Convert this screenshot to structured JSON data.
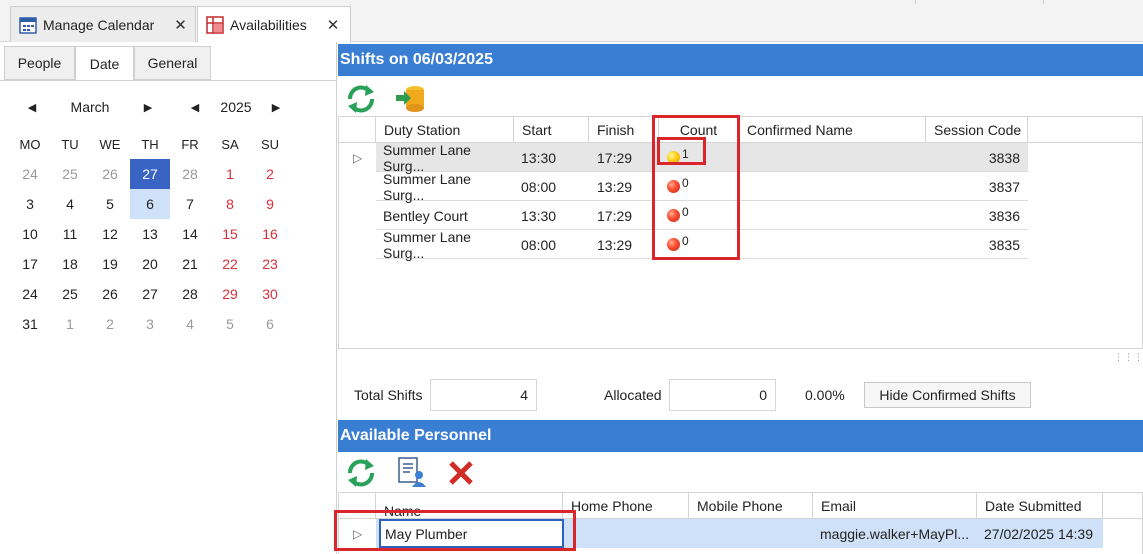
{
  "tabs": [
    {
      "label": "Manage Calendar",
      "close": "✕"
    },
    {
      "label": "Availabilities",
      "close": "✕"
    }
  ],
  "left": {
    "sub_tabs": [
      "People",
      "Date",
      "General"
    ],
    "month": "March",
    "year": "2025",
    "prev": "◀",
    "next": "▶",
    "weekdays": [
      "MO",
      "TU",
      "WE",
      "TH",
      "FR",
      "SA",
      "SU"
    ],
    "weeks": [
      [
        "24",
        "25",
        "26",
        "27",
        "28",
        "1",
        "2"
      ],
      [
        "3",
        "4",
        "5",
        "6",
        "7",
        "8",
        "9"
      ],
      [
        "10",
        "11",
        "12",
        "13",
        "14",
        "15",
        "16"
      ],
      [
        "17",
        "18",
        "19",
        "20",
        "21",
        "22",
        "23"
      ],
      [
        "24",
        "25",
        "26",
        "27",
        "28",
        "29",
        "30"
      ],
      [
        "31",
        "1",
        "2",
        "3",
        "4",
        "5",
        "6"
      ]
    ]
  },
  "shifts": {
    "title": "Shifts on  06/03/2025",
    "columns": [
      "Duty Station",
      "Start",
      "Finish",
      "Count",
      "Confirmed Name",
      "Session Code"
    ],
    "rows": [
      {
        "station": "Summer Lane Surg...",
        "start": "13:30",
        "finish": "17:29",
        "count": "1",
        "status": "yellow",
        "confirmed": "",
        "code": "3838"
      },
      {
        "station": "Summer Lane Surg...",
        "start": "08:00",
        "finish": "13:29",
        "count": "0",
        "status": "red",
        "confirmed": "",
        "code": "3837"
      },
      {
        "station": "Bentley Court",
        "start": "13:30",
        "finish": "17:29",
        "count": "0",
        "status": "red",
        "confirmed": "",
        "code": "3836"
      },
      {
        "station": "Summer Lane Surg...",
        "start": "08:00",
        "finish": "13:29",
        "count": "0",
        "status": "red",
        "confirmed": "",
        "code": "3835"
      }
    ],
    "total_label": "Total Shifts",
    "total_value": "4",
    "allocated_label": "Allocated",
    "allocated_value": "0",
    "percent": "0.00%",
    "hide_button": "Hide Confirmed Shifts"
  },
  "personnel": {
    "title": "Available Personnel",
    "columns": [
      "Name",
      "Home Phone",
      "Mobile Phone",
      "Email",
      "Date Submitted"
    ],
    "rows": [
      {
        "name": "May Plumber",
        "home": "",
        "mobile": "",
        "email": "maggie.walker+MayPl...",
        "date": "27/02/2025 14:39"
      }
    ]
  },
  "colors": {
    "accent": "#3a7ed4",
    "highlight": "#d9262d",
    "today": "#3a64c4"
  }
}
